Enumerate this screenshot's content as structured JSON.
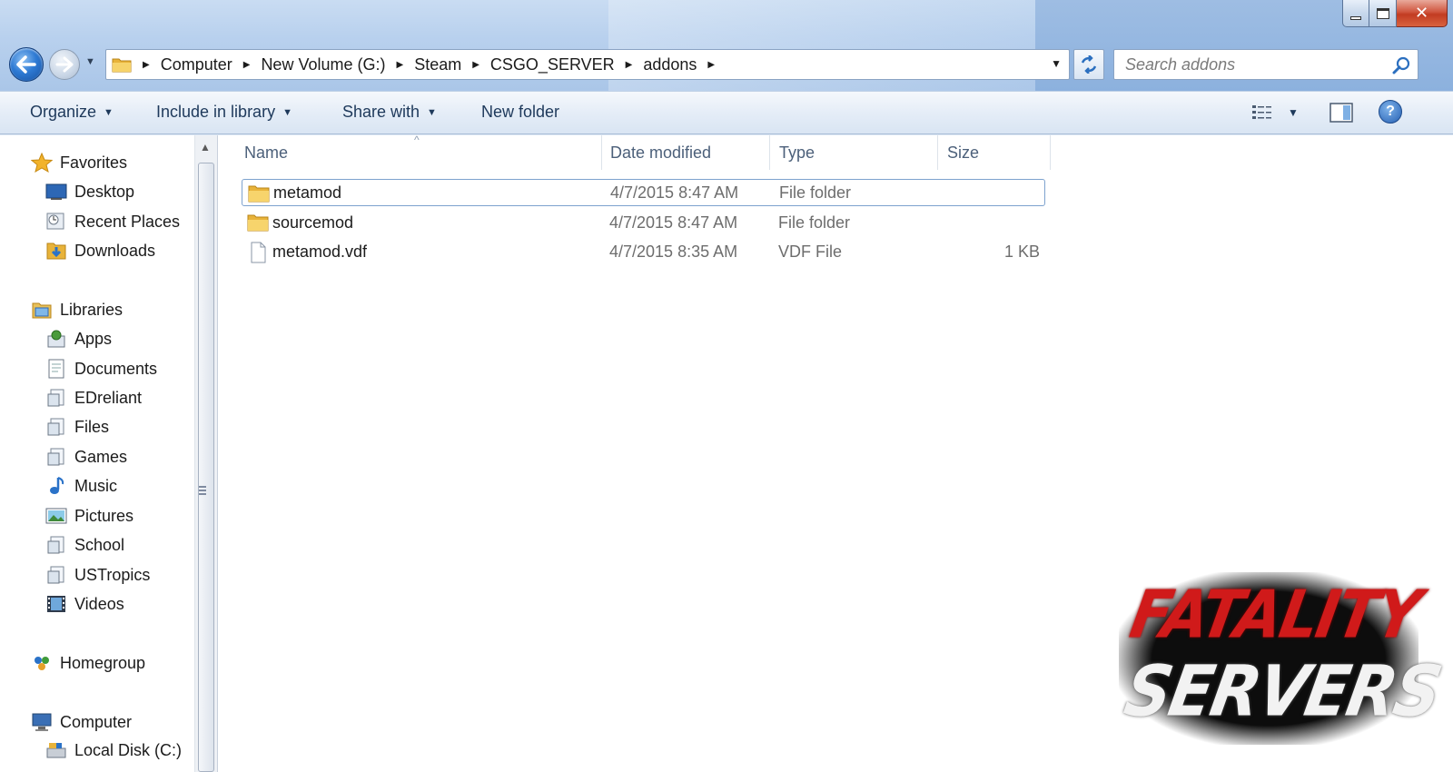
{
  "address": {
    "crumbs": [
      "Computer",
      "New Volume (G:)",
      "Steam",
      "CSGO_SERVER",
      "addons"
    ]
  },
  "search": {
    "placeholder": "Search addons"
  },
  "toolbar": {
    "organize": "Organize",
    "include_in_library": "Include in library",
    "share_with": "Share with",
    "new_folder": "New folder"
  },
  "nav": {
    "favorites": "Favorites",
    "favorites_items": [
      "Desktop",
      "Recent Places",
      "Downloads"
    ],
    "libraries": "Libraries",
    "libraries_items": [
      "Apps",
      "Documents",
      "EDreliant",
      "Files",
      "Games",
      "Music",
      "Pictures",
      "School",
      "USTropics",
      "Videos"
    ],
    "homegroup": "Homegroup",
    "computer": "Computer",
    "computer_items": [
      "Local Disk (C:)"
    ]
  },
  "columns": {
    "name": "Name",
    "date": "Date modified",
    "type": "Type",
    "size": "Size"
  },
  "files": [
    {
      "name": "metamod",
      "date": "4/7/2015 8:47 AM",
      "type": "File folder",
      "size": "",
      "icon": "folder-icon",
      "selected": true
    },
    {
      "name": "sourcemod",
      "date": "4/7/2015 8:47 AM",
      "type": "File folder",
      "size": "",
      "icon": "folder-icon",
      "selected": false
    },
    {
      "name": "metamod.vdf",
      "date": "4/7/2015 8:35 AM",
      "type": "VDF File",
      "size": "1 KB",
      "icon": "file-icon",
      "selected": false
    }
  ],
  "watermark": {
    "line1": "FATALITY",
    "line2": "SERVERS"
  },
  "colors": {
    "accent": "#2e7ad4",
    "selection_border": "#7da2ce",
    "watermark_red": "#d01a1a"
  }
}
